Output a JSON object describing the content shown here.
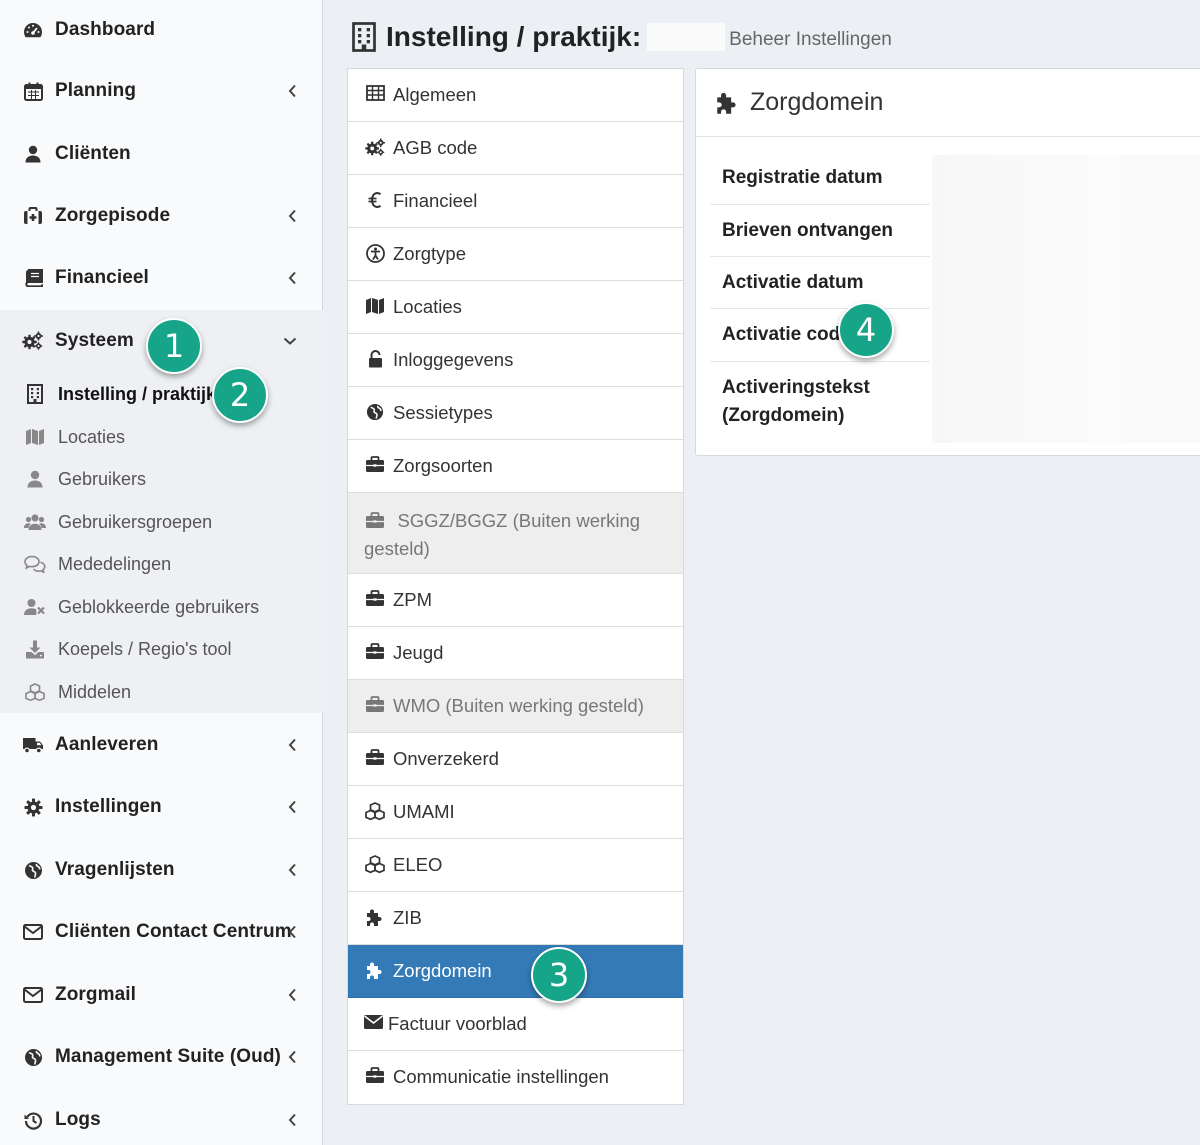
{
  "sidebar": {
    "items": [
      {
        "label": "Dashboard",
        "icon": "dashboard-icon"
      },
      {
        "label": "Planning",
        "icon": "calendar-icon"
      },
      {
        "label": "Cliënten",
        "icon": "user-icon"
      },
      {
        "label": "Zorgepisode",
        "icon": "medkit-icon"
      },
      {
        "label": "Financieel",
        "icon": "book-icon"
      },
      {
        "label": "Systeem",
        "icon": "gears-icon"
      },
      {
        "label": "Aanleveren",
        "icon": "truck-icon"
      },
      {
        "label": "Instellingen",
        "icon": "gear-icon"
      },
      {
        "label": "Vragenlijsten",
        "icon": "globe-icon"
      },
      {
        "label": "Cliënten Contact Centrum",
        "icon": "envelope-icon"
      },
      {
        "label": "Zorgmail",
        "icon": "envelope-icon"
      },
      {
        "label": "Management Suite (Oud)",
        "icon": "globe-icon"
      },
      {
        "label": "Logs",
        "icon": "history-icon"
      }
    ],
    "subitems": [
      {
        "label": "Instelling / praktijk",
        "icon": "building-icon",
        "active": true
      },
      {
        "label": "Locaties",
        "icon": "map-icon"
      },
      {
        "label": "Gebruikers",
        "icon": "user-icon"
      },
      {
        "label": "Gebruikersgroepen",
        "icon": "users-icon"
      },
      {
        "label": "Mededelingen",
        "icon": "comments-icon"
      },
      {
        "label": "Geblokkeerde gebruikers",
        "icon": "user-times-icon"
      },
      {
        "label": "Koepels / Regio's tool",
        "icon": "download-icon"
      },
      {
        "label": "Middelen",
        "icon": "cubes-icon"
      }
    ]
  },
  "header": {
    "title": "Instelling / praktijk:",
    "subtitle": "Beheer Instellingen",
    "icon": "building-icon"
  },
  "settings_list": [
    {
      "label": "Algemeen",
      "icon": "table-icon"
    },
    {
      "label": "AGB code",
      "icon": "gears-icon"
    },
    {
      "label": "Financieel",
      "icon": "euro-icon"
    },
    {
      "label": "Zorgtype",
      "icon": "accessibility-icon"
    },
    {
      "label": "Locaties",
      "icon": "map-icon"
    },
    {
      "label": "Inloggegevens",
      "icon": "unlock-icon"
    },
    {
      "label": "Sessietypes",
      "icon": "globe-icon"
    },
    {
      "label": "Zorgsoorten",
      "icon": "briefcase-icon"
    },
    {
      "label": "SGGZ/BGGZ (Buiten werking gesteld)",
      "icon": "briefcase-icon",
      "disabled": true
    },
    {
      "label": "ZPM",
      "icon": "briefcase-icon"
    },
    {
      "label": "Jeugd",
      "icon": "briefcase-icon"
    },
    {
      "label": "WMO (Buiten werking gesteld)",
      "icon": "briefcase-icon",
      "disabled": true
    },
    {
      "label": "Onverzekerd",
      "icon": "briefcase-icon"
    },
    {
      "label": "UMAMI",
      "icon": "cubes-icon"
    },
    {
      "label": "ELEO",
      "icon": "cubes-icon"
    },
    {
      "label": "ZIB",
      "icon": "puzzle-icon"
    },
    {
      "label": "Zorgdomein",
      "icon": "puzzle-icon",
      "active": true
    },
    {
      "label": "Factuur voorblad",
      "icon": "envelope-icon"
    },
    {
      "label": "Communicatie instellingen",
      "icon": "briefcase-icon"
    }
  ],
  "detail": {
    "title": "Zorgdomein",
    "icon": "puzzle-icon",
    "rows": [
      {
        "label": "Registratie datum"
      },
      {
        "label": "Brieven ontvangen"
      },
      {
        "label": "Activatie datum"
      },
      {
        "label": "Activatie code"
      },
      {
        "label": "Activeringstekst (Zorgdomein)"
      }
    ]
  },
  "callouts": [
    "1",
    "2",
    "3",
    "4"
  ],
  "colors": {
    "accent": "#337ab7",
    "badge": "#17a589"
  }
}
